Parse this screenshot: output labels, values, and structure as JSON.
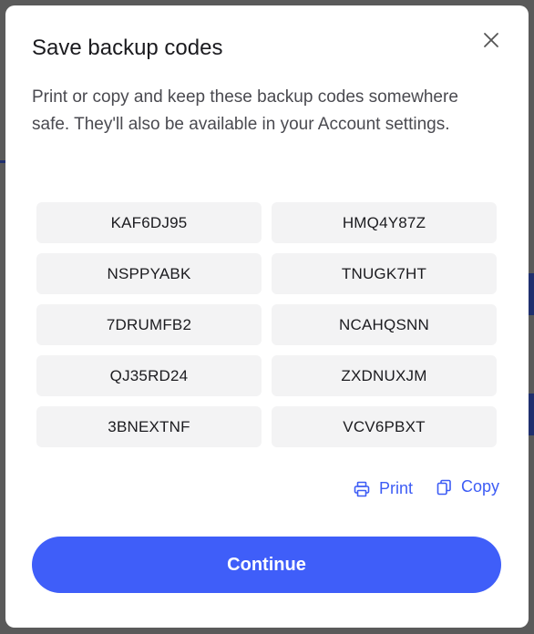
{
  "modal": {
    "title": "Save backup codes",
    "description": "Print or copy and keep these backup codes somewhere safe. They'll also be available in your Account settings.",
    "close_icon": "close-icon"
  },
  "codes": [
    "KAF6DJ95",
    "HMQ4Y87Z",
    "NSPPYABK",
    "TNUGK7HT",
    "7DRUMFB2",
    "NCAHQSNN",
    "QJ35RD24",
    "ZXDNUXJM",
    "3BNEXTNF",
    "VCV6PBXT"
  ],
  "actions": {
    "print_label": "Print",
    "print_icon": "printer-icon",
    "copy_label": "Copy",
    "copy_icon": "copy-icon"
  },
  "continue_label": "Continue",
  "colors": {
    "accent": "#3f5ef9",
    "link": "#3d5cf5",
    "code_bg": "#f3f3f4",
    "overlay": "#5a5a5a"
  }
}
